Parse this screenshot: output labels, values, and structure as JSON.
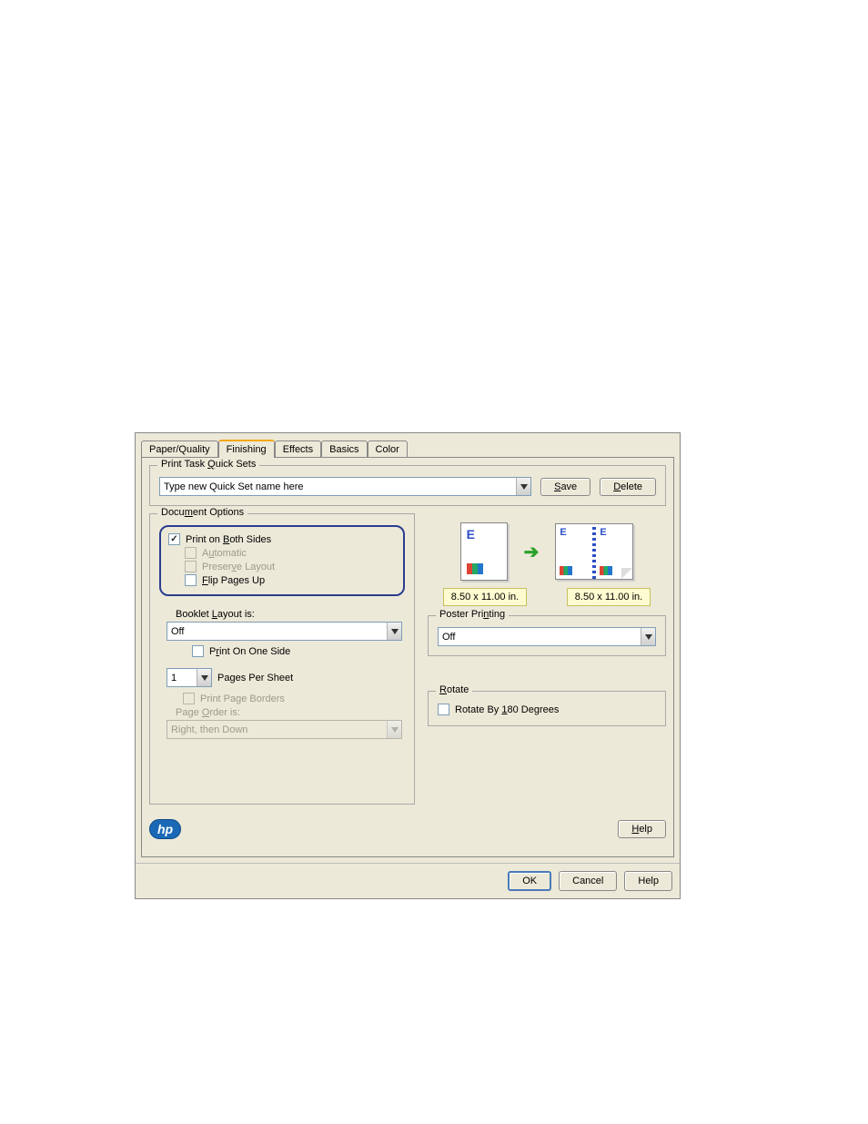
{
  "tabs": {
    "paper_quality": "Paper/Quality",
    "finishing": "Finishing",
    "effects": "Effects",
    "basics": "Basics",
    "color": "Color"
  },
  "quicksets": {
    "group": "Print Task Quick Sets",
    "placeholder": "Type new Quick Set name here",
    "save": "Save",
    "delete": "Delete"
  },
  "doc_options": {
    "group": "Document Options",
    "print_both": "Print on Both Sides",
    "automatic": "Automatic",
    "preserve": "Preserve Layout",
    "flip": "Flip Pages Up",
    "booklet_label": "Booklet Layout is:",
    "booklet_value": "Off",
    "print_one": "Print On One Side",
    "pps_value": "1",
    "pps_label": "Pages Per Sheet",
    "borders": "Print Page Borders",
    "order_label": "Page Order is:",
    "order_value": "Right, then Down"
  },
  "dimensions": {
    "left": "8.50 x 11.00 in.",
    "right": "8.50 x 11.00 in."
  },
  "poster": {
    "group": "Poster Printing",
    "value": "Off"
  },
  "rotate": {
    "group": "Rotate",
    "label": "Rotate By 180 Degrees"
  },
  "hp_logo": "hp",
  "help_inner": "Help",
  "buttons": {
    "ok": "OK",
    "cancel": "Cancel",
    "help": "Help"
  }
}
